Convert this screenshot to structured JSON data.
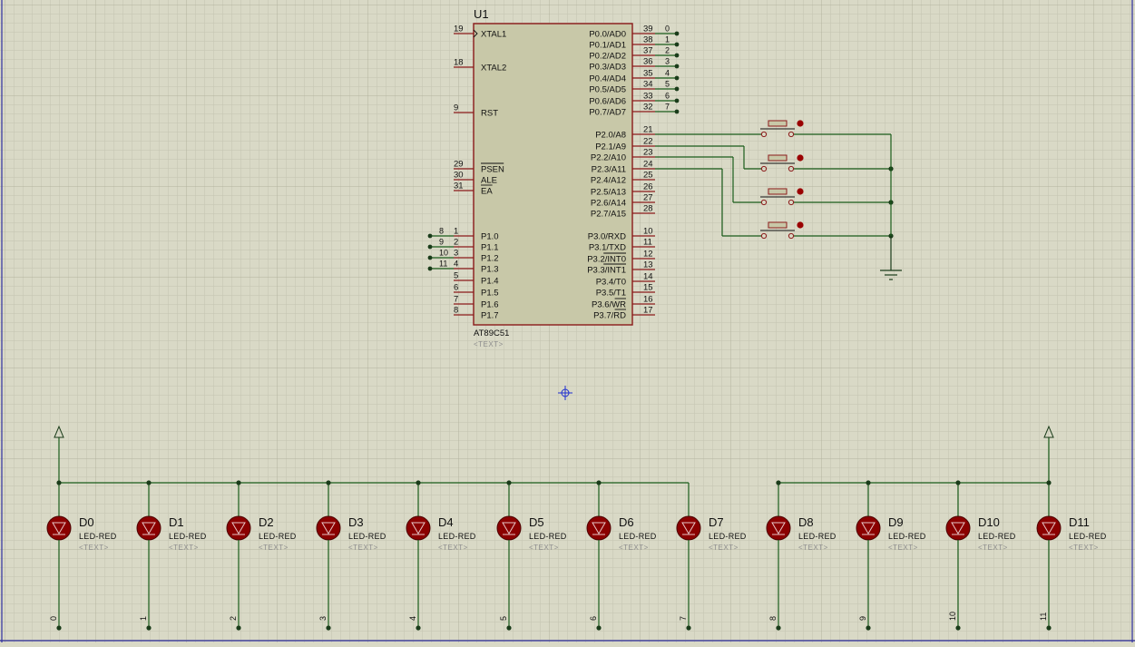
{
  "colors": {
    "background": "#d9d9c6",
    "grid_minor": "#c4c4b0",
    "grid_major": "#b2b29e",
    "chip_fill": "#c8c8a8",
    "chip_border": "#8b1a1a",
    "pin_line": "#8b1a1a",
    "wire": "#1a5c1a",
    "junction": "#1a3c1a",
    "led_fill": "#8b0000",
    "button_dot": "#9a0000",
    "sheet_border": "#3030a0",
    "cursor": "#2030d0"
  },
  "chip": {
    "ref": "U1",
    "part": "AT89C51",
    "text_placeholder": "<TEXT>",
    "left_pins": [
      {
        "num": "19",
        "name": "XTAL1"
      },
      {
        "num": "18",
        "name": "XTAL2"
      },
      {
        "num": "9",
        "name": "RST"
      },
      {
        "num": "29",
        "name": "PSEN"
      },
      {
        "num": "30",
        "name": "ALE"
      },
      {
        "num": "31",
        "name": "EA"
      },
      {
        "num": "1",
        "name": "P1.0",
        "net": "8"
      },
      {
        "num": "2",
        "name": "P1.1",
        "net": "9"
      },
      {
        "num": "3",
        "name": "P1.2",
        "net": "10"
      },
      {
        "num": "4",
        "name": "P1.3",
        "net": "11"
      },
      {
        "num": "5",
        "name": "P1.4"
      },
      {
        "num": "6",
        "name": "P1.5"
      },
      {
        "num": "7",
        "name": "P1.6"
      },
      {
        "num": "8",
        "name": "P1.7"
      }
    ],
    "right_pins": [
      {
        "num": "39",
        "name": "P0.0/AD0",
        "net": "0"
      },
      {
        "num": "38",
        "name": "P0.1/AD1",
        "net": "1"
      },
      {
        "num": "37",
        "name": "P0.2/AD2",
        "net": "2"
      },
      {
        "num": "36",
        "name": "P0.3/AD3",
        "net": "3"
      },
      {
        "num": "35",
        "name": "P0.4/AD4",
        "net": "4"
      },
      {
        "num": "34",
        "name": "P0.5/AD5",
        "net": "5"
      },
      {
        "num": "33",
        "name": "P0.6/AD6",
        "net": "6"
      },
      {
        "num": "32",
        "name": "P0.7/AD7",
        "net": "7"
      },
      {
        "num": "21",
        "name": "P2.0/A8"
      },
      {
        "num": "22",
        "name": "P2.1/A9"
      },
      {
        "num": "23",
        "name": "P2.2/A10"
      },
      {
        "num": "24",
        "name": "P2.3/A11"
      },
      {
        "num": "25",
        "name": "P2.4/A12"
      },
      {
        "num": "26",
        "name": "P2.5/A13"
      },
      {
        "num": "27",
        "name": "P2.6/A14"
      },
      {
        "num": "28",
        "name": "P2.7/A15"
      },
      {
        "num": "10",
        "name": "P3.0/RXD"
      },
      {
        "num": "11",
        "name": "P3.1/TXD"
      },
      {
        "num": "12",
        "name": "P3.2/INT0"
      },
      {
        "num": "13",
        "name": "P3.3/INT1"
      },
      {
        "num": "14",
        "name": "P3.4/T0"
      },
      {
        "num": "15",
        "name": "P3.5/T1"
      },
      {
        "num": "16",
        "name": "P3.6/WR"
      },
      {
        "num": "17",
        "name": "P3.7/RD"
      }
    ]
  },
  "buttons_count": 4,
  "leds": [
    {
      "ref": "D0",
      "value": "LED-RED",
      "text": "<TEXT>",
      "net": "0"
    },
    {
      "ref": "D1",
      "value": "LED-RED",
      "text": "<TEXT>",
      "net": "1"
    },
    {
      "ref": "D2",
      "value": "LED-RED",
      "text": "<TEXT>",
      "net": "2"
    },
    {
      "ref": "D3",
      "value": "LED-RED",
      "text": "<TEXT>",
      "net": "3"
    },
    {
      "ref": "D4",
      "value": "LED-RED",
      "text": "<TEXT>",
      "net": "4"
    },
    {
      "ref": "D5",
      "value": "LED-RED",
      "text": "<TEXT>",
      "net": "5"
    },
    {
      "ref": "D6",
      "value": "LED-RED",
      "text": "<TEXT>",
      "net": "6"
    },
    {
      "ref": "D7",
      "value": "LED-RED",
      "text": "<TEXT>",
      "net": "7"
    },
    {
      "ref": "D8",
      "value": "LED-RED",
      "text": "<TEXT>",
      "net": "8"
    },
    {
      "ref": "D9",
      "value": "LED-RED",
      "text": "<TEXT>",
      "net": "9"
    },
    {
      "ref": "D10",
      "value": "LED-RED",
      "text": "<TEXT>",
      "net": "10"
    },
    {
      "ref": "D11",
      "value": "LED-RED",
      "text": "<TEXT>",
      "net": "11"
    }
  ]
}
